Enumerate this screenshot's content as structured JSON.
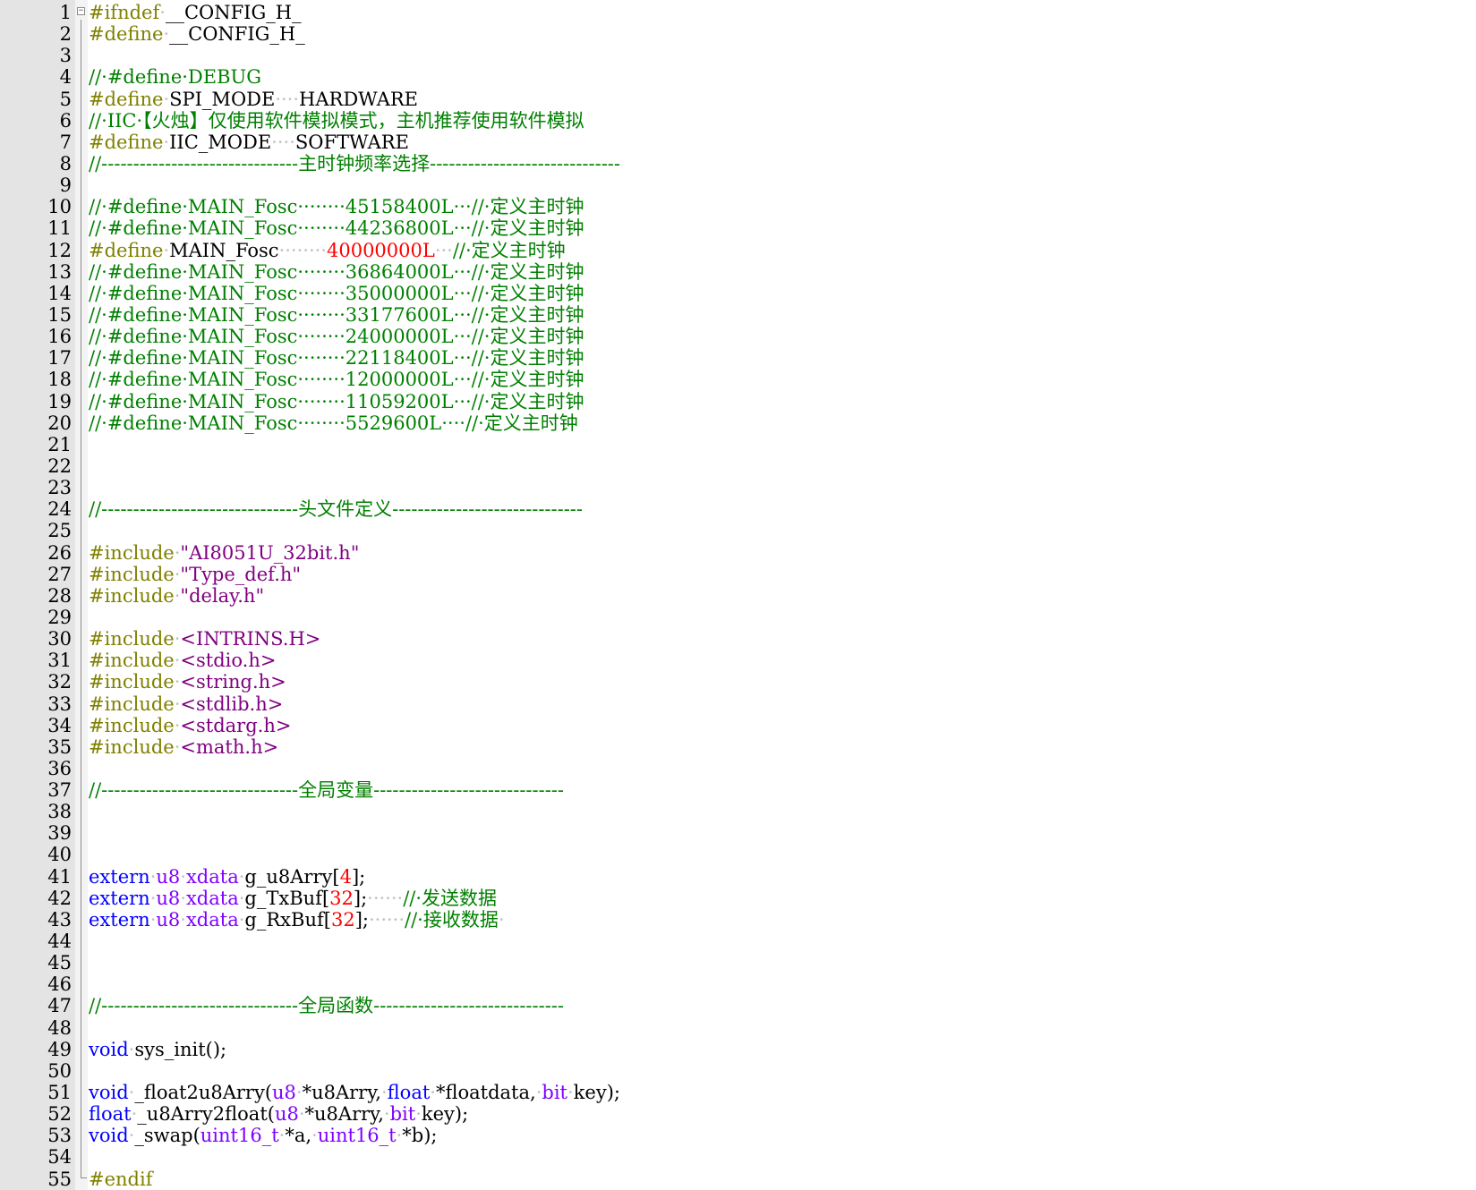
{
  "editor": {
    "colors": {
      "comment": "#008000",
      "preprocessor": "#808000",
      "keyword": "#0000ff",
      "type": "#8000ff",
      "number": "#ff0000",
      "string": "#800080",
      "plain": "#000000",
      "whitespace_marker": "#c0c0c0",
      "gutter": "#e4e4e4"
    },
    "fold_marker": "⊟",
    "lines": [
      {
        "n": "1",
        "tokens": [
          [
            "pre",
            "#ifndef"
          ],
          [
            "ws",
            "·"
          ],
          [
            "plain",
            "__CONFIG_H_"
          ]
        ]
      },
      {
        "n": "2",
        "tokens": [
          [
            "pre",
            "#define"
          ],
          [
            "ws",
            "·"
          ],
          [
            "plain",
            "__CONFIG_H_"
          ]
        ]
      },
      {
        "n": "3",
        "tokens": []
      },
      {
        "n": "4",
        "tokens": [
          [
            "comment",
            "//·#define·DEBUG"
          ]
        ]
      },
      {
        "n": "5",
        "tokens": [
          [
            "pre",
            "#define"
          ],
          [
            "ws",
            "·"
          ],
          [
            "plain",
            "SPI_MODE"
          ],
          [
            "ws",
            "····"
          ],
          [
            "plain",
            "HARDWARE"
          ]
        ]
      },
      {
        "n": "6",
        "tokens": [
          [
            "comment",
            "//·IIC·【火烛】仅使用软件模拟模式，主机推荐使用软件模拟"
          ]
        ]
      },
      {
        "n": "7",
        "tokens": [
          [
            "pre",
            "#define"
          ],
          [
            "ws",
            "·"
          ],
          [
            "plain",
            "IIC_MODE"
          ],
          [
            "ws",
            "····"
          ],
          [
            "plain",
            "SOFTWARE"
          ]
        ]
      },
      {
        "n": "8",
        "tokens": [
          [
            "comment",
            "//-------------------------------主时钟频率选择------------------------------"
          ]
        ]
      },
      {
        "n": "9",
        "tokens": []
      },
      {
        "n": "10",
        "tokens": [
          [
            "comment",
            "//·#define·MAIN_Fosc········45158400L···//·定义主时钟"
          ]
        ]
      },
      {
        "n": "11",
        "tokens": [
          [
            "comment",
            "//·#define·MAIN_Fosc········44236800L···//·定义主时钟"
          ]
        ]
      },
      {
        "n": "12",
        "tokens": [
          [
            "pre",
            "#define"
          ],
          [
            "ws",
            "·"
          ],
          [
            "plain",
            "MAIN_Fosc"
          ],
          [
            "ws",
            "········"
          ],
          [
            "num",
            "40000000L"
          ],
          [
            "ws",
            "···"
          ],
          [
            "comment",
            "//·定义主时钟"
          ]
        ]
      },
      {
        "n": "13",
        "tokens": [
          [
            "comment",
            "//·#define·MAIN_Fosc········36864000L···//·定义主时钟"
          ]
        ]
      },
      {
        "n": "14",
        "tokens": [
          [
            "comment",
            "//·#define·MAIN_Fosc········35000000L···//·定义主时钟"
          ]
        ]
      },
      {
        "n": "15",
        "tokens": [
          [
            "comment",
            "//·#define·MAIN_Fosc········33177600L···//·定义主时钟"
          ]
        ]
      },
      {
        "n": "16",
        "tokens": [
          [
            "comment",
            "//·#define·MAIN_Fosc········24000000L···//·定义主时钟"
          ]
        ]
      },
      {
        "n": "17",
        "tokens": [
          [
            "comment",
            "//·#define·MAIN_Fosc········22118400L···//·定义主时钟"
          ]
        ]
      },
      {
        "n": "18",
        "tokens": [
          [
            "comment",
            "//·#define·MAIN_Fosc········12000000L···//·定义主时钟"
          ]
        ]
      },
      {
        "n": "19",
        "tokens": [
          [
            "comment",
            "//·#define·MAIN_Fosc········11059200L···//·定义主时钟"
          ]
        ]
      },
      {
        "n": "20",
        "tokens": [
          [
            "comment",
            "//·#define·MAIN_Fosc········5529600L····//·定义主时钟"
          ]
        ]
      },
      {
        "n": "21",
        "tokens": []
      },
      {
        "n": "22",
        "tokens": []
      },
      {
        "n": "23",
        "tokens": []
      },
      {
        "n": "24",
        "tokens": [
          [
            "comment",
            "//-------------------------------头文件定义------------------------------"
          ]
        ]
      },
      {
        "n": "25",
        "tokens": []
      },
      {
        "n": "26",
        "tokens": [
          [
            "pre",
            "#include"
          ],
          [
            "ws",
            "·"
          ],
          [
            "str",
            "\"AI8051U_32bit.h\""
          ]
        ]
      },
      {
        "n": "27",
        "tokens": [
          [
            "pre",
            "#include"
          ],
          [
            "ws",
            "·"
          ],
          [
            "str",
            "\"Type_def.h\""
          ]
        ]
      },
      {
        "n": "28",
        "tokens": [
          [
            "pre",
            "#include"
          ],
          [
            "ws",
            "·"
          ],
          [
            "str",
            "\"delay.h\""
          ]
        ]
      },
      {
        "n": "29",
        "tokens": []
      },
      {
        "n": "30",
        "tokens": [
          [
            "pre",
            "#include"
          ],
          [
            "ws",
            "·"
          ],
          [
            "str",
            "<INTRINS.H>"
          ]
        ]
      },
      {
        "n": "31",
        "tokens": [
          [
            "pre",
            "#include"
          ],
          [
            "ws",
            "·"
          ],
          [
            "str",
            "<stdio.h>"
          ]
        ]
      },
      {
        "n": "32",
        "tokens": [
          [
            "pre",
            "#include"
          ],
          [
            "ws",
            "·"
          ],
          [
            "str",
            "<string.h>"
          ]
        ]
      },
      {
        "n": "33",
        "tokens": [
          [
            "pre",
            "#include"
          ],
          [
            "ws",
            "·"
          ],
          [
            "str",
            "<stdlib.h>"
          ]
        ]
      },
      {
        "n": "34",
        "tokens": [
          [
            "pre",
            "#include"
          ],
          [
            "ws",
            "·"
          ],
          [
            "str",
            "<stdarg.h>"
          ]
        ]
      },
      {
        "n": "35",
        "tokens": [
          [
            "pre",
            "#include"
          ],
          [
            "ws",
            "·"
          ],
          [
            "str",
            "<math.h>"
          ]
        ]
      },
      {
        "n": "36",
        "tokens": []
      },
      {
        "n": "37",
        "tokens": [
          [
            "comment",
            "//-------------------------------全局变量------------------------------"
          ]
        ]
      },
      {
        "n": "38",
        "tokens": []
      },
      {
        "n": "39",
        "tokens": []
      },
      {
        "n": "40",
        "tokens": []
      },
      {
        "n": "41",
        "tokens": [
          [
            "kw",
            "extern"
          ],
          [
            "ws",
            "·"
          ],
          [
            "type",
            "u8"
          ],
          [
            "ws",
            "·"
          ],
          [
            "type",
            "xdata"
          ],
          [
            "ws",
            "·"
          ],
          [
            "plain",
            "g_u8Arry["
          ],
          [
            "num",
            "4"
          ],
          [
            "plain",
            "];"
          ]
        ]
      },
      {
        "n": "42",
        "tokens": [
          [
            "kw",
            "extern"
          ],
          [
            "ws",
            "·"
          ],
          [
            "type",
            "u8"
          ],
          [
            "ws",
            "·"
          ],
          [
            "type",
            "xdata"
          ],
          [
            "ws",
            "·"
          ],
          [
            "plain",
            "g_TxBuf["
          ],
          [
            "num",
            "32"
          ],
          [
            "plain",
            "];"
          ],
          [
            "ws",
            "······"
          ],
          [
            "comment",
            "//·发送数据"
          ]
        ]
      },
      {
        "n": "43",
        "tokens": [
          [
            "kw",
            "extern"
          ],
          [
            "ws",
            "·"
          ],
          [
            "type",
            "u8"
          ],
          [
            "ws",
            "·"
          ],
          [
            "type",
            "xdata"
          ],
          [
            "ws",
            "·"
          ],
          [
            "plain",
            "g_RxBuf["
          ],
          [
            "num",
            "32"
          ],
          [
            "plain",
            "];"
          ],
          [
            "ws",
            "······"
          ],
          [
            "comment",
            "//·接收数据"
          ],
          [
            "ws",
            "·"
          ]
        ]
      },
      {
        "n": "44",
        "tokens": []
      },
      {
        "n": "45",
        "tokens": []
      },
      {
        "n": "46",
        "tokens": []
      },
      {
        "n": "47",
        "tokens": [
          [
            "comment",
            "//-------------------------------全局函数------------------------------"
          ]
        ]
      },
      {
        "n": "48",
        "tokens": []
      },
      {
        "n": "49",
        "tokens": [
          [
            "kw",
            "void"
          ],
          [
            "ws",
            "·"
          ],
          [
            "plain",
            "sys_init();"
          ]
        ]
      },
      {
        "n": "50",
        "tokens": []
      },
      {
        "n": "51",
        "tokens": [
          [
            "kw",
            "void"
          ],
          [
            "ws",
            "·"
          ],
          [
            "plain",
            "_float2u8Arry("
          ],
          [
            "type",
            "u8"
          ],
          [
            "ws",
            "·"
          ],
          [
            "plain",
            "*u8Arry,"
          ],
          [
            "ws",
            "·"
          ],
          [
            "kw",
            "float"
          ],
          [
            "ws",
            "·"
          ],
          [
            "plain",
            "*floatdata,"
          ],
          [
            "ws",
            "·"
          ],
          [
            "type",
            "bit"
          ],
          [
            "ws",
            "·"
          ],
          [
            "plain",
            "key);"
          ]
        ]
      },
      {
        "n": "52",
        "tokens": [
          [
            "kw",
            "float"
          ],
          [
            "ws",
            "·"
          ],
          [
            "plain",
            "_u8Arry2float("
          ],
          [
            "type",
            "u8"
          ],
          [
            "ws",
            "·"
          ],
          [
            "plain",
            "*u8Arry,"
          ],
          [
            "ws",
            "·"
          ],
          [
            "type",
            "bit"
          ],
          [
            "ws",
            "·"
          ],
          [
            "plain",
            "key);"
          ]
        ]
      },
      {
        "n": "53",
        "tokens": [
          [
            "kw",
            "void"
          ],
          [
            "ws",
            "·"
          ],
          [
            "plain",
            "_swap("
          ],
          [
            "type",
            "uint16_t"
          ],
          [
            "ws",
            "·"
          ],
          [
            "plain",
            "*a,"
          ],
          [
            "ws",
            "·"
          ],
          [
            "type",
            "uint16_t"
          ],
          [
            "ws",
            "·"
          ],
          [
            "plain",
            "*b);"
          ]
        ]
      },
      {
        "n": "54",
        "tokens": []
      },
      {
        "n": "55",
        "tokens": [
          [
            "pre",
            "#endif"
          ]
        ]
      }
    ]
  }
}
